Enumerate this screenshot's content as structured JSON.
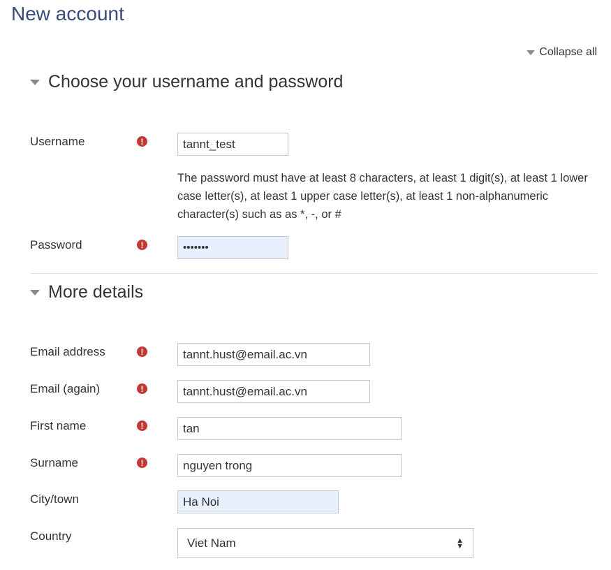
{
  "page": {
    "title": "New account"
  },
  "header": {
    "collapse_label": "Collapse all"
  },
  "sections": [
    {
      "title": "Choose your username and password"
    },
    {
      "title": "More details"
    }
  ],
  "fields": {
    "username": {
      "label": "Username",
      "value": "tannt_test"
    },
    "password_help": "The password must have at least 8 characters, at least 1 digit(s), at least 1 lower case letter(s), at least 1 upper case letter(s), at least 1 non-alphanumeric character(s) such as as *, -, or #",
    "password": {
      "label": "Password",
      "value": "•••••••"
    },
    "email": {
      "label": "Email address",
      "value": "tannt.hust@email.ac.vn"
    },
    "email_again": {
      "label": "Email (again)",
      "value": "tannt.hust@email.ac.vn"
    },
    "first_name": {
      "label": "First name",
      "value": "tan"
    },
    "surname": {
      "label": "Surname",
      "value": "nguyen trong"
    },
    "city": {
      "label": "City/town",
      "value": "Ha Noi"
    },
    "country": {
      "label": "Country",
      "value": "Viet Nam"
    }
  },
  "icons": {
    "required": "exclamation-circle-icon",
    "expand": "caret-down-icon"
  },
  "colors": {
    "title": "#374a7a",
    "required": "#c23832",
    "autofill_bg": "#e8f0fe"
  }
}
